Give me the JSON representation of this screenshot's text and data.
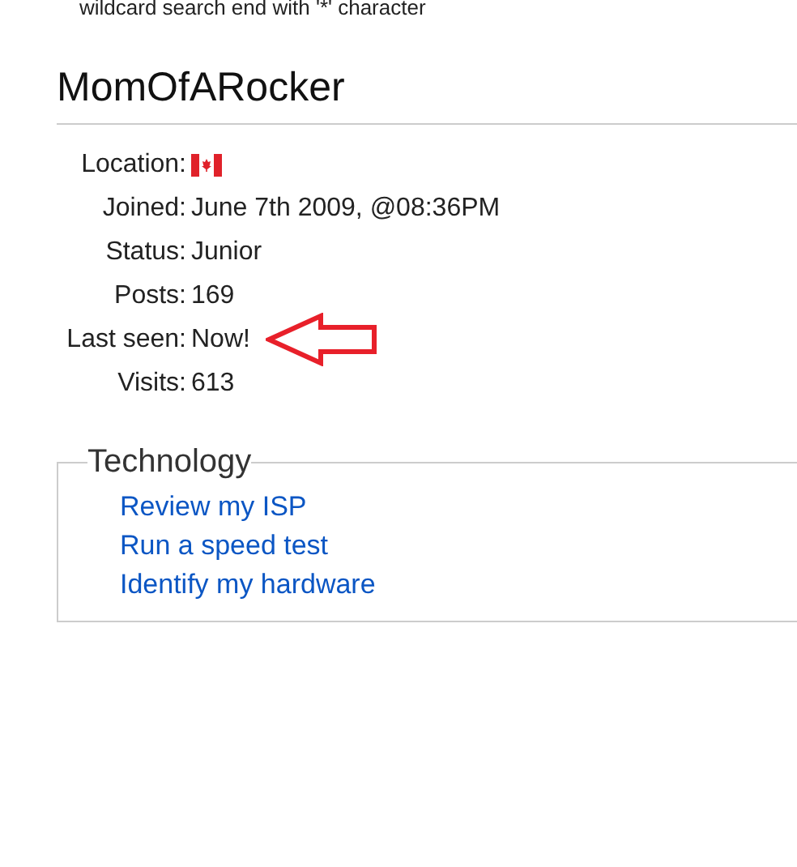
{
  "search_hint": "wildcard search end with '*' character",
  "profile": {
    "name": "MomOfARocker",
    "fields": [
      {
        "label": "Location:",
        "kind": "flag",
        "marked": false
      },
      {
        "label": "Joined:",
        "kind": "text",
        "value": "June 7th 2009, @08:36PM",
        "marked": false
      },
      {
        "label": "Status:",
        "kind": "text",
        "value": "Junior",
        "marked": false
      },
      {
        "label": "Posts:",
        "kind": "text",
        "value": "169",
        "marked": false
      },
      {
        "label": "Last seen:",
        "kind": "text",
        "value": "Now!",
        "marked": true
      },
      {
        "label": "Visits:",
        "kind": "text",
        "value": "613",
        "marked": false
      }
    ]
  },
  "technology": {
    "legend": "Technology",
    "links": [
      "Review my ISP",
      "Run a speed test",
      "Identify my hardware"
    ]
  }
}
